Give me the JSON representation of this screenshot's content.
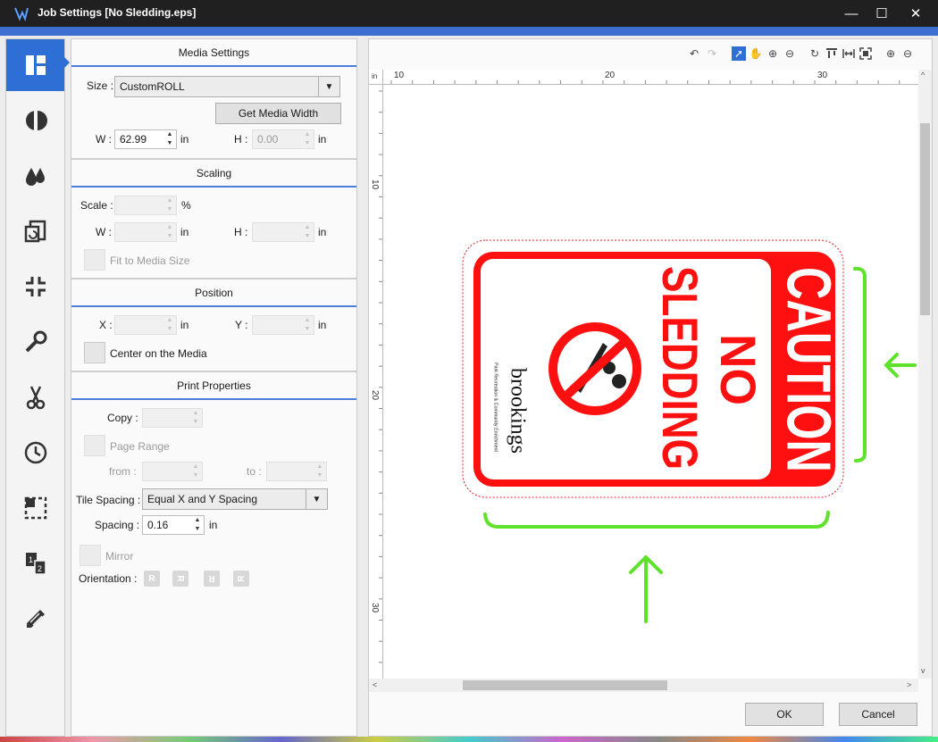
{
  "window": {
    "title": "Job Settings [No Sledding.eps]",
    "minimize_glyph": "—",
    "maximize_glyph": "☐",
    "close_glyph": "✕"
  },
  "rail": {
    "items": [
      {
        "name": "layout-icon",
        "active": true
      },
      {
        "name": "color-adjust-icon"
      },
      {
        "name": "ink-drops-icon"
      },
      {
        "name": "replicate-icon"
      },
      {
        "name": "fit-shrink-icon"
      },
      {
        "name": "wrench-icon"
      },
      {
        "name": "scissors-icon"
      },
      {
        "name": "clock-icon"
      },
      {
        "name": "crop-marks-icon"
      },
      {
        "name": "page-order-icon"
      },
      {
        "name": "color-swatch-icon"
      }
    ]
  },
  "media": {
    "header": "Media Settings",
    "size_label": "Size :",
    "size_value": "CustomROLL",
    "get_width_label": "Get Media Width",
    "w_label": "W :",
    "w_value": "62.99",
    "w_unit": "in",
    "h_label": "H :",
    "h_value": "0.00",
    "h_unit": "in"
  },
  "scaling": {
    "header": "Scaling",
    "scale_label": "Scale :",
    "scale_unit": "%",
    "w_label": "W :",
    "w_unit": "in",
    "h_label": "H :",
    "h_unit": "in",
    "fit_label": "Fit to Media Size"
  },
  "position": {
    "header": "Position",
    "x_label": "X :",
    "x_unit": "in",
    "y_label": "Y :",
    "y_unit": "in",
    "center_label": "Center on the Media"
  },
  "print": {
    "header": "Print Properties",
    "copy_label": "Copy :",
    "page_range_label": "Page Range",
    "from_label": "from :",
    "to_label": "to :",
    "tile_label": "Tile Spacing :",
    "tile_value": "Equal X and Y Spacing",
    "spacing_label": "Spacing :",
    "spacing_value": "0.16",
    "spacing_unit": "in",
    "mirror_label": "Mirror",
    "orientation_label": "Orientation :",
    "orientation_glyphs": [
      "R",
      "R",
      "R",
      "R"
    ]
  },
  "preview": {
    "ruler_unit": "in",
    "ruler_top": [
      "10",
      "20",
      "30"
    ],
    "ruler_left": [
      "10",
      "20",
      "30"
    ],
    "sign": {
      "caution": "CAUTION",
      "no": "NO",
      "sledding": "SLEDDING",
      "brand": "brookings",
      "tagline": "Park Recreation & Community Enrichment",
      "colors": {
        "red": "#ff1010",
        "annotation": "#5fe22c"
      }
    },
    "toolbar_icons": [
      "undo-icon",
      "redo-icon",
      "select-arrow-icon",
      "pan-hand-icon",
      "zoom-in-icon",
      "zoom-out-icon",
      "rotate-icon",
      "align-top-icon",
      "fit-width-icon",
      "fit-page-icon",
      "add-icon",
      "remove-icon"
    ]
  },
  "buttons": {
    "ok": "OK",
    "cancel": "Cancel"
  },
  "glyphs": {
    "up": "▲",
    "down": "▼",
    "dropdown": "▼",
    "undo": "↶",
    "redo": "↷",
    "pointer": "➚",
    "hand": "✋",
    "zoom_in": "⊕",
    "zoom_out": "⊖",
    "rotate": "↻",
    "left": "<",
    "right": ">",
    "up_small": "^",
    "down_small": "v"
  }
}
